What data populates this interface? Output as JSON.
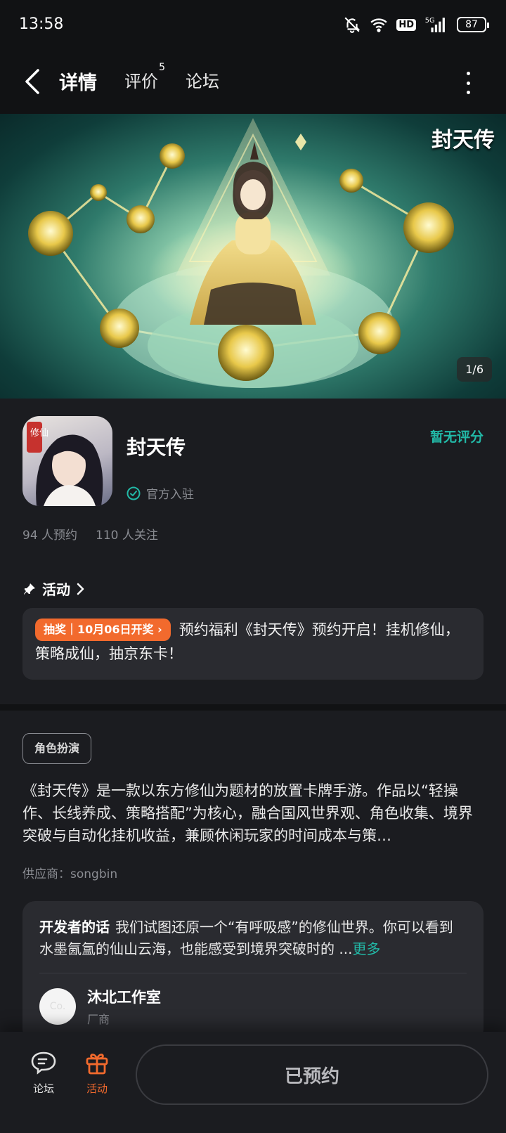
{
  "status_bar": {
    "time": "13:58",
    "network": "5G",
    "hd_label": "HD",
    "battery": "87"
  },
  "nav": {
    "tabs": [
      {
        "label": "详情",
        "active": true
      },
      {
        "label": "评价",
        "badge": "5"
      },
      {
        "label": "论坛"
      }
    ]
  },
  "banner": {
    "logo_text": "封天传",
    "counter": "1/6"
  },
  "app": {
    "name": "封天传",
    "icon_text": "修仙",
    "rating": "暂无评分",
    "official_label": "官方入驻",
    "reservations": "94 人预约",
    "followers": "110 人关注"
  },
  "activity": {
    "section_title": "活动",
    "badge": "抽奖｜10月06日开奖 ›",
    "text": "预约福利《封天传》预约开启！挂机修仙，策略成仙，抽京东卡！"
  },
  "description": {
    "genre_tag": "角色扮演",
    "text": "《封天传》是一款以东方修仙为题材的放置卡牌手游。作品以“轻操作、长线养成、策略搭配”为核心，融合国风世界观、角色收集、境界突破与自动化挂机收益，兼顾休闲玩家的时间成本与策…",
    "supplier": "供应商：songbin"
  },
  "developer": {
    "title": "开发者的话",
    "text": "我们试图还原一个“有呼吸感”的修仙世界。你可以看到水墨氤氲的仙山云海，也能感受到境界突破时的 ...",
    "more": "更多",
    "studio_name": "沐北工作室",
    "studio_role": "厂商",
    "avatar_text": "Co."
  },
  "bottom_bar": {
    "forum_label": "论坛",
    "activity_label": "活动",
    "primary_button": "已预约"
  },
  "colors": {
    "accent": "#22b9a7",
    "orange": "#f26a2d",
    "background": "#1b1c20",
    "card": "#2a2b30"
  }
}
